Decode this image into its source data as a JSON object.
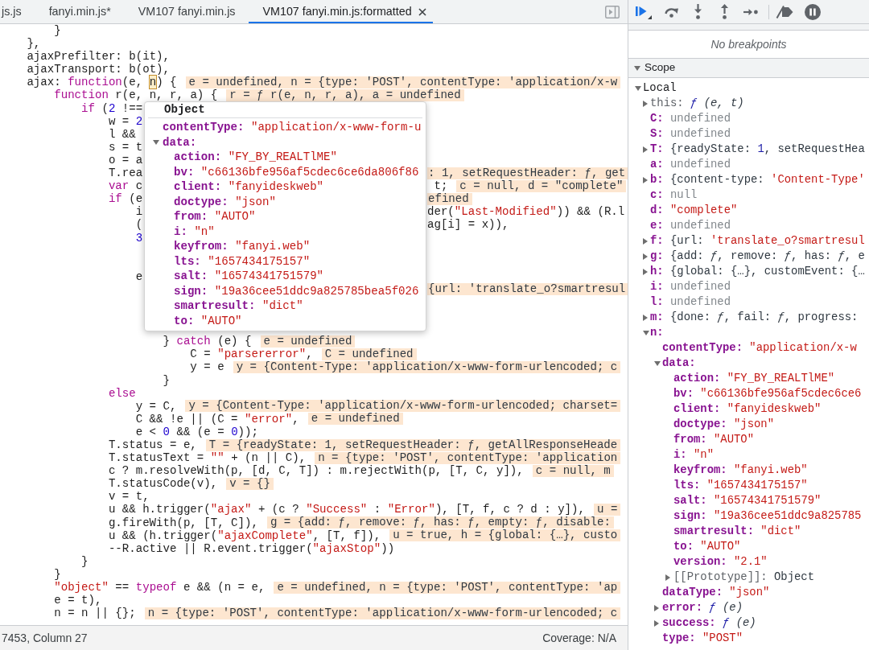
{
  "editor": {
    "tabs": [
      {
        "label": "js.js",
        "selected": false
      },
      {
        "label": "fanyi.min.js*",
        "selected": false
      },
      {
        "label": "VM107 fanyi.min.js",
        "selected": false
      },
      {
        "label": "VM107 fanyi.min.js:formatted",
        "selected": true
      }
    ],
    "code_lines": [
      {
        "kind": "code",
        "code": [
          {
            "kind": "plain",
            "text": "    }"
          }
        ]
      },
      {
        "kind": "code",
        "code": [
          {
            "kind": "plain",
            "text": "},"
          }
        ]
      },
      {
        "kind": "code",
        "code": [
          {
            "kind": "plain",
            "text": "ajaxPrefilter: b(it),"
          }
        ]
      },
      {
        "kind": "code",
        "code": [
          {
            "kind": "plain",
            "text": "ajaxTransport: b(ot),"
          }
        ]
      },
      {
        "kind": "code",
        "code": [
          {
            "kind": "plain",
            "text": "ajax: "
          },
          {
            "kind": "keyword",
            "text": "function"
          },
          {
            "kind": "plain",
            "text": "(e, "
          },
          {
            "kind": "hover",
            "text": "n"
          },
          {
            "kind": "plain",
            "text": ") {"
          }
        ],
        "inline_value": "e = undefined, n = {type: 'POST', contentType: 'application/x-w"
      },
      {
        "kind": "code",
        "code": [
          {
            "kind": "keyword",
            "text": "    function"
          },
          {
            "kind": "plain",
            "text": " r(e, n, r, a) {"
          }
        ],
        "inline_value": "r = ƒ r(e, n, r, a), a = undefined"
      },
      {
        "kind": "code",
        "code": [
          {
            "kind": "keyword",
            "text": "        if"
          },
          {
            "kind": "plain",
            "text": " ("
          },
          {
            "kind": "number",
            "text": "2"
          },
          {
            "kind": "plain",
            "text": " !=="
          }
        ]
      },
      {
        "kind": "code",
        "code": [
          {
            "kind": "plain",
            "text": "            w = "
          },
          {
            "kind": "number",
            "text": "2"
          }
        ]
      },
      {
        "kind": "code",
        "code": [
          {
            "kind": "plain",
            "text": "            l &&"
          }
        ]
      },
      {
        "kind": "code",
        "code": [
          {
            "kind": "plain",
            "text": "            s = t"
          }
        ]
      },
      {
        "kind": "code",
        "code": [
          {
            "kind": "plain",
            "text": "            o = a"
          }
        ]
      },
      {
        "kind": "code",
        "code": [
          {
            "kind": "plain",
            "text": "            T.rea"
          }
        ],
        "beyond_popup": {
          "inline_value": ": 1, setRequestHeader: ƒ, get"
        }
      },
      {
        "kind": "code",
        "code": [
          {
            "kind": "keyword",
            "text": "            var"
          },
          {
            "kind": "plain",
            "text": " c"
          }
        ],
        "beyond_popup": {
          "code": [
            {
              "kind": "plain",
              "text": " t;"
            }
          ],
          "inline_value": "c = null, d = \"complete\""
        }
      },
      {
        "kind": "code",
        "code": [
          {
            "kind": "keyword",
            "text": "            if"
          },
          {
            "kind": "plain",
            "text": " (e"
          }
        ],
        "beyond_popup": {
          "inline_value": "efined"
        }
      },
      {
        "kind": "code",
        "code": [
          {
            "kind": "plain",
            "text": "                i"
          }
        ],
        "beyond_popup": {
          "code": [
            {
              "kind": "plain",
              "text": "der("
            },
            {
              "kind": "string",
              "text": "\"Last-Modified\""
            },
            {
              "kind": "plain",
              "text": ")) && (R.l"
            }
          ]
        }
      },
      {
        "kind": "code",
        "code": [
          {
            "kind": "plain",
            "text": "                ("
          }
        ],
        "beyond_popup": {
          "code": [
            {
              "kind": "plain",
              "text": "ag[i] = x)),"
            }
          ]
        }
      },
      {
        "kind": "code",
        "code": [
          {
            "kind": "number",
            "text": "                3"
          }
        ]
      },
      {
        "kind": "covered"
      },
      {
        "kind": "covered"
      },
      {
        "kind": "code",
        "code": [
          {
            "kind": "plain",
            "text": "                e"
          }
        ]
      },
      {
        "kind": "code",
        "beyond_popup": {
          "inline_value": "{url: 'translate_o?smartresul"
        }
      },
      {
        "kind": "covered"
      },
      {
        "kind": "covered"
      },
      {
        "kind": "covered"
      },
      {
        "kind": "code",
        "code": [
          {
            "kind": "plain",
            "text": "                    } "
          },
          {
            "kind": "keyword",
            "text": "catch"
          },
          {
            "kind": "plain",
            "text": " (e) {"
          }
        ],
        "inline_value": "e = undefined"
      },
      {
        "kind": "code",
        "code": [
          {
            "kind": "plain",
            "text": "                        C = "
          },
          {
            "kind": "string",
            "text": "\"parsererror\""
          },
          {
            "kind": "plain",
            "text": ","
          }
        ],
        "inline_value": "C = undefined"
      },
      {
        "kind": "code",
        "code": [
          {
            "kind": "plain",
            "text": "                        y = e"
          }
        ],
        "inline_value": "y = {Content-Type: 'application/x-www-form-urlencoded; c"
      },
      {
        "kind": "code",
        "code": [
          {
            "kind": "plain",
            "text": "                    }"
          }
        ]
      },
      {
        "kind": "code",
        "code": [
          {
            "kind": "keyword",
            "text": "            else"
          }
        ]
      },
      {
        "kind": "code",
        "code": [
          {
            "kind": "plain",
            "text": "                y = C,"
          }
        ],
        "inline_value": "y = {Content-Type: 'application/x-www-form-urlencoded; charset="
      },
      {
        "kind": "code",
        "code": [
          {
            "kind": "plain",
            "text": "                C && !e || (C = "
          },
          {
            "kind": "string",
            "text": "\"error\""
          },
          {
            "kind": "plain",
            "text": ","
          }
        ],
        "inline_value": "e = undefined"
      },
      {
        "kind": "code",
        "code": [
          {
            "kind": "plain",
            "text": "                e < "
          },
          {
            "kind": "number",
            "text": "0"
          },
          {
            "kind": "plain",
            "text": " && (e = "
          },
          {
            "kind": "number",
            "text": "0"
          },
          {
            "kind": "plain",
            "text": "));"
          }
        ]
      },
      {
        "kind": "code",
        "code": [
          {
            "kind": "plain",
            "text": "            T.status = e,"
          }
        ],
        "inline_value": "T = {readyState: 1, setRequestHeader: ƒ, getAllResponseHeade"
      },
      {
        "kind": "code",
        "code": [
          {
            "kind": "plain",
            "text": "            T.statusText = "
          },
          {
            "kind": "string",
            "text": "\"\""
          },
          {
            "kind": "plain",
            "text": " + (n || C),"
          }
        ],
        "inline_value": "n = {type: 'POST', contentType: 'application"
      },
      {
        "kind": "code",
        "code": [
          {
            "kind": "plain",
            "text": "            c ? m.resolveWith(p, [d, C, T]) : m.rejectWith(p, [T, C, y]),"
          }
        ],
        "inline_value": "c = null, m"
      },
      {
        "kind": "code",
        "code": [
          {
            "kind": "plain",
            "text": "            T.statusCode(v),"
          }
        ],
        "inline_value": "v = {}"
      },
      {
        "kind": "code",
        "code": [
          {
            "kind": "plain",
            "text": "            v = t,"
          }
        ]
      },
      {
        "kind": "code",
        "code": [
          {
            "kind": "plain",
            "text": "            u && h.trigger("
          },
          {
            "kind": "string",
            "text": "\"ajax\""
          },
          {
            "kind": "plain",
            "text": " + (c ? "
          },
          {
            "kind": "string",
            "text": "\"Success\""
          },
          {
            "kind": "plain",
            "text": " : "
          },
          {
            "kind": "string",
            "text": "\"Error\""
          },
          {
            "kind": "plain",
            "text": "), [T, f, c ? d : y]),"
          }
        ],
        "inline_value": "u ="
      },
      {
        "kind": "code",
        "code": [
          {
            "kind": "plain",
            "text": "            g.fireWith(p, [T, C]),"
          }
        ],
        "inline_value": "g = {add: ƒ, remove: ƒ, has: ƒ, empty: ƒ, disable:"
      },
      {
        "kind": "code",
        "code": [
          {
            "kind": "plain",
            "text": "            u && (h.trigger("
          },
          {
            "kind": "string",
            "text": "\"ajaxComplete\""
          },
          {
            "kind": "plain",
            "text": ", [T, f]),"
          }
        ],
        "inline_value": "u = true, h = {global: {…}, custo"
      },
      {
        "kind": "code",
        "code": [
          {
            "kind": "plain",
            "text": "            --R.active || R.event.trigger("
          },
          {
            "kind": "string",
            "text": "\"ajaxStop\""
          },
          {
            "kind": "plain",
            "text": "))"
          }
        ]
      },
      {
        "kind": "code",
        "code": [
          {
            "kind": "plain",
            "text": "        }"
          }
        ]
      },
      {
        "kind": "code",
        "code": [
          {
            "kind": "plain",
            "text": "    }"
          }
        ]
      },
      {
        "kind": "code",
        "code": [
          {
            "kind": "string",
            "text": "    \"object\""
          },
          {
            "kind": "plain",
            "text": " == "
          },
          {
            "kind": "keyword",
            "text": "typeof"
          },
          {
            "kind": "plain",
            "text": " e && (n = e,"
          }
        ],
        "inline_value": "e = undefined, n = {type: 'POST', contentType: 'ap"
      },
      {
        "kind": "code",
        "code": [
          {
            "kind": "plain",
            "text": "    e = t),"
          }
        ]
      },
      {
        "kind": "code",
        "code": [
          {
            "kind": "plain",
            "text": "    n = n || {};"
          }
        ],
        "inline_value": "n = {type: 'POST', contentType: 'application/x-www-form-urlencoded; c"
      }
    ],
    "hover_popup": {
      "title": "Object",
      "properties": [
        {
          "key": "contentType:",
          "kind": "property",
          "value": [
            {
              "kind": "string",
              "text": "\"application/x-www-form-u"
            }
          ]
        },
        {
          "key": "data:",
          "kind": "property",
          "expanded": true,
          "children": [
            {
              "key": "action:",
              "kind": "property",
              "value": [
                {
                  "kind": "string",
                  "text": "\"FY_BY_REALTlME\""
                }
              ]
            },
            {
              "key": "bv:",
              "kind": "property",
              "value": [
                {
                  "kind": "string",
                  "text": "\"c66136bfe956af5cdec6ce6da806f86"
                }
              ]
            },
            {
              "key": "client:",
              "kind": "property",
              "value": [
                {
                  "kind": "string",
                  "text": "\"fanyideskweb\""
                }
              ]
            },
            {
              "key": "doctype:",
              "kind": "property",
              "value": [
                {
                  "kind": "string",
                  "text": "\"json\""
                }
              ]
            },
            {
              "key": "from:",
              "kind": "property",
              "value": [
                {
                  "kind": "string",
                  "text": "\"AUTO\""
                }
              ]
            },
            {
              "key": "i:",
              "kind": "property",
              "value": [
                {
                  "kind": "string",
                  "text": "\"n\""
                }
              ]
            },
            {
              "key": "keyfrom:",
              "kind": "property",
              "value": [
                {
                  "kind": "string",
                  "text": "\"fanyi.web\""
                }
              ]
            },
            {
              "key": "lts:",
              "kind": "property",
              "value": [
                {
                  "kind": "string",
                  "text": "\"1657434175157\""
                }
              ]
            },
            {
              "key": "salt:",
              "kind": "property",
              "value": [
                {
                  "kind": "string",
                  "text": "\"16574341751579\""
                }
              ]
            },
            {
              "key": "sign:",
              "kind": "property",
              "value": [
                {
                  "kind": "string",
                  "text": "\"19a36cee51ddc9a825785bea5f026"
                }
              ]
            },
            {
              "key": "smartresult:",
              "kind": "property",
              "value": [
                {
                  "kind": "string",
                  "text": "\"dict\""
                }
              ]
            },
            {
              "key": "to:",
              "kind": "property",
              "value": [
                {
                  "kind": "string",
                  "text": "\"AUTO\""
                }
              ]
            }
          ]
        }
      ]
    },
    "status_bar": {
      "cursor_position": "7453, Column 27",
      "coverage": "Coverage: N/A"
    }
  },
  "debugger": {
    "breakpoints": {
      "empty_message": "No breakpoints"
    },
    "scope": {
      "title": "Scope",
      "expanded": true,
      "groups": [
        {
          "label": "Local",
          "expanded": true,
          "children": [
            {
              "key": "this:",
              "kind": "internal",
              "expanded": false,
              "value": [
                {
                  "kind": "fn",
                  "text": "ƒ"
                },
                {
                  "kind": "italic",
                  "text": " (e, t)"
                }
              ]
            },
            {
              "key": "C:",
              "kind": "property",
              "value": [
                {
                  "kind": "empty",
                  "text": "undefined"
                }
              ]
            },
            {
              "key": "S:",
              "kind": "property",
              "value": [
                {
                  "kind": "empty",
                  "text": "undefined"
                }
              ]
            },
            {
              "key": "T:",
              "kind": "property",
              "expanded": false,
              "value": [
                {
                  "kind": "plain",
                  "text": "{readyState: "
                },
                {
                  "kind": "number",
                  "text": "1"
                },
                {
                  "kind": "plain",
                  "text": ", setRequestHea"
                }
              ]
            },
            {
              "key": "a:",
              "kind": "property",
              "value": [
                {
                  "kind": "empty",
                  "text": "undefined"
                }
              ]
            },
            {
              "key": "b:",
              "kind": "property",
              "expanded": false,
              "value": [
                {
                  "kind": "plain",
                  "text": "{content-type: "
                },
                {
                  "kind": "string",
                  "text": "'Content-Type'"
                }
              ]
            },
            {
              "key": "c:",
              "kind": "property",
              "value": [
                {
                  "kind": "empty",
                  "text": "null"
                }
              ]
            },
            {
              "key": "d:",
              "kind": "property",
              "value": [
                {
                  "kind": "string",
                  "text": "\"complete\""
                }
              ]
            },
            {
              "key": "e:",
              "kind": "property",
              "value": [
                {
                  "kind": "empty",
                  "text": "undefined"
                }
              ]
            },
            {
              "key": "f:",
              "kind": "property",
              "expanded": false,
              "value": [
                {
                  "kind": "plain",
                  "text": "{url: "
                },
                {
                  "kind": "string",
                  "text": "'translate_o?smartresul"
                }
              ]
            },
            {
              "key": "g:",
              "kind": "property",
              "expanded": false,
              "value": [
                {
                  "kind": "plain",
                  "text": "{add: "
                },
                {
                  "kind": "italic",
                  "text": "ƒ"
                },
                {
                  "kind": "plain",
                  "text": ", remove: "
                },
                {
                  "kind": "italic",
                  "text": "ƒ"
                },
                {
                  "kind": "plain",
                  "text": ", has: "
                },
                {
                  "kind": "italic",
                  "text": "ƒ"
                },
                {
                  "kind": "plain",
                  "text": ", e"
                }
              ]
            },
            {
              "key": "h:",
              "kind": "property",
              "expanded": false,
              "value": [
                {
                  "kind": "plain",
                  "text": "{global: {…}, customEvent: {…"
                }
              ]
            },
            {
              "key": "i:",
              "kind": "property",
              "value": [
                {
                  "kind": "empty",
                  "text": "undefined"
                }
              ]
            },
            {
              "key": "l:",
              "kind": "property",
              "value": [
                {
                  "kind": "empty",
                  "text": "undefined"
                }
              ]
            },
            {
              "key": "m:",
              "kind": "property",
              "expanded": false,
              "value": [
                {
                  "kind": "plain",
                  "text": "{done: "
                },
                {
                  "kind": "italic",
                  "text": "ƒ"
                },
                {
                  "kind": "plain",
                  "text": ", fail: "
                },
                {
                  "kind": "italic",
                  "text": "ƒ"
                },
                {
                  "kind": "plain",
                  "text": ", progress:"
                }
              ]
            },
            {
              "key": "n:",
              "kind": "property",
              "expanded": true,
              "children": [
                {
                  "key": "contentType:",
                  "kind": "property",
                  "value": [
                    {
                      "kind": "string",
                      "text": "\"application/x-w"
                    }
                  ]
                },
                {
                  "key": "data:",
                  "kind": "property",
                  "expanded": true,
                  "children": [
                    {
                      "key": "action:",
                      "kind": "property",
                      "value": [
                        {
                          "kind": "string",
                          "text": "\"FY_BY_REALTlME\""
                        }
                      ]
                    },
                    {
                      "key": "bv:",
                      "kind": "property",
                      "value": [
                        {
                          "kind": "string",
                          "text": "\"c66136bfe956af5cdec6ce6"
                        }
                      ]
                    },
                    {
                      "key": "client:",
                      "kind": "property",
                      "value": [
                        {
                          "kind": "string",
                          "text": "\"fanyideskweb\""
                        }
                      ]
                    },
                    {
                      "key": "doctype:",
                      "kind": "property",
                      "value": [
                        {
                          "kind": "string",
                          "text": "\"json\""
                        }
                      ]
                    },
                    {
                      "key": "from:",
                      "kind": "property",
                      "value": [
                        {
                          "kind": "string",
                          "text": "\"AUTO\""
                        }
                      ]
                    },
                    {
                      "key": "i:",
                      "kind": "property",
                      "value": [
                        {
                          "kind": "string",
                          "text": "\"n\""
                        }
                      ]
                    },
                    {
                      "key": "keyfrom:",
                      "kind": "property",
                      "value": [
                        {
                          "kind": "string",
                          "text": "\"fanyi.web\""
                        }
                      ]
                    },
                    {
                      "key": "lts:",
                      "kind": "property",
                      "value": [
                        {
                          "kind": "string",
                          "text": "\"1657434175157\""
                        }
                      ]
                    },
                    {
                      "key": "salt:",
                      "kind": "property",
                      "value": [
                        {
                          "kind": "string",
                          "text": "\"16574341751579\""
                        }
                      ]
                    },
                    {
                      "key": "sign:",
                      "kind": "property",
                      "value": [
                        {
                          "kind": "string",
                          "text": "\"19a36cee51ddc9a825785"
                        }
                      ]
                    },
                    {
                      "key": "smartresult:",
                      "kind": "property",
                      "value": [
                        {
                          "kind": "string",
                          "text": "\"dict\""
                        }
                      ]
                    },
                    {
                      "key": "to:",
                      "kind": "property",
                      "value": [
                        {
                          "kind": "string",
                          "text": "\"AUTO\""
                        }
                      ]
                    },
                    {
                      "key": "version:",
                      "kind": "property",
                      "value": [
                        {
                          "kind": "string",
                          "text": "\"2.1\""
                        }
                      ]
                    },
                    {
                      "key": "[[Prototype]]:",
                      "kind": "internal",
                      "expanded": false,
                      "value": [
                        {
                          "kind": "plain",
                          "text": "Object"
                        }
                      ]
                    }
                  ]
                },
                {
                  "key": "dataType:",
                  "kind": "property",
                  "value": [
                    {
                      "kind": "string",
                      "text": "\"json\""
                    }
                  ]
                },
                {
                  "key": "error:",
                  "kind": "property",
                  "expanded": false,
                  "value": [
                    {
                      "kind": "fn",
                      "text": "ƒ"
                    },
                    {
                      "kind": "italic",
                      "text": " (e)"
                    }
                  ]
                },
                {
                  "key": "success:",
                  "kind": "property",
                  "expanded": false,
                  "value": [
                    {
                      "kind": "fn",
                      "text": "ƒ"
                    },
                    {
                      "kind": "italic",
                      "text": " (e)"
                    }
                  ]
                },
                {
                  "key": "type:",
                  "kind": "property",
                  "value": [
                    {
                      "kind": "string",
                      "text": "\"POST\""
                    }
                  ]
                }
              ]
            }
          ]
        }
      ]
    }
  }
}
